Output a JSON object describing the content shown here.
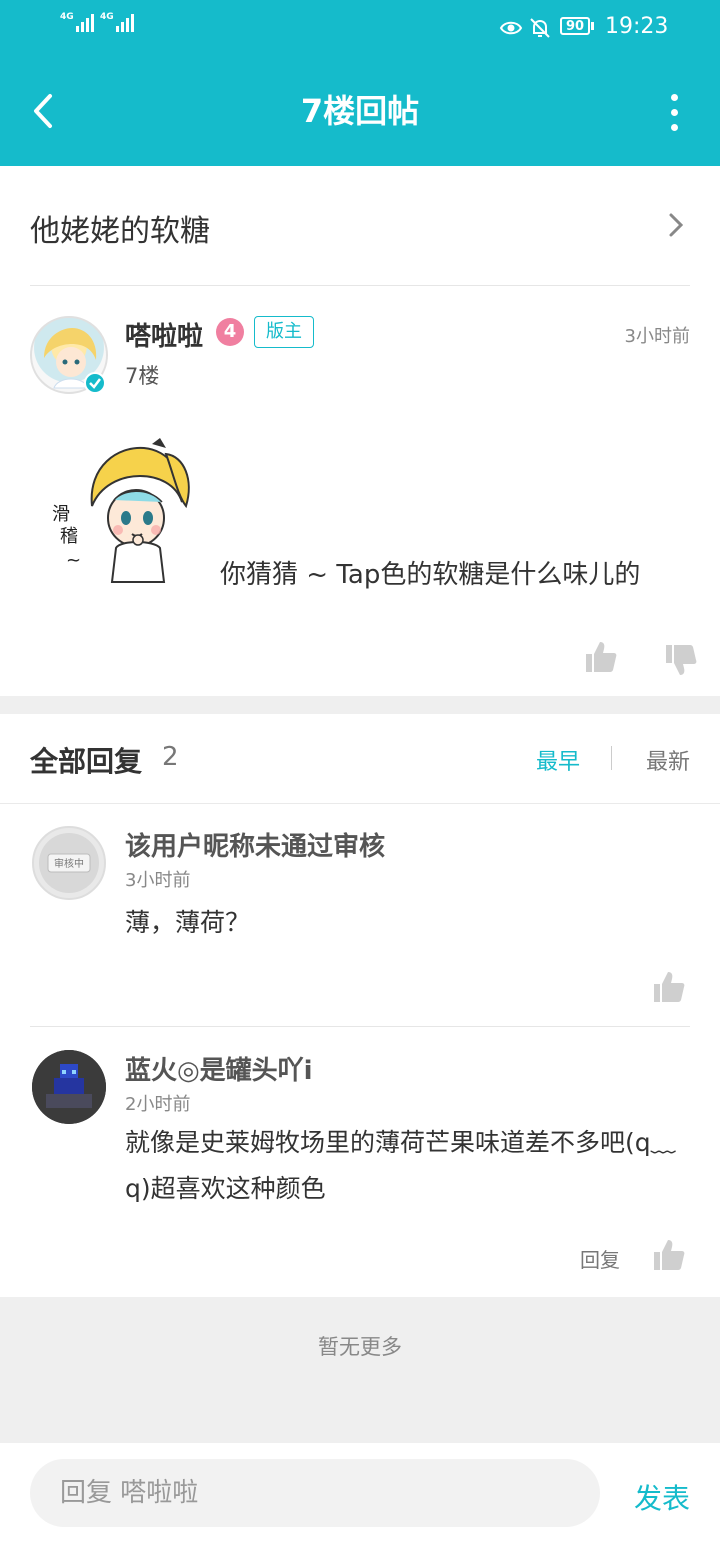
{
  "status_bar": {
    "signal1": "4G",
    "signal2": "4G",
    "battery": "90",
    "time": "19:23"
  },
  "header": {
    "title": "7楼回帖"
  },
  "topic": {
    "title": "他姥姥的软糖"
  },
  "post": {
    "author": "嗒啦啦",
    "level": "4",
    "role": "版主",
    "time": "3小时前",
    "floor": "7楼",
    "text": "你猜猜 ~ Tap色的软糖是什么味儿的",
    "sticker_text": "滑稽~"
  },
  "replies": {
    "label": "全部回复",
    "count": "2",
    "sort_early": "最早",
    "sort_new": "最新",
    "items": [
      {
        "name": "该用户昵称未通过审核",
        "time": "3小时前",
        "text": "薄，薄荷？",
        "avatar_text": "审核中",
        "reply_label": ""
      },
      {
        "name": "蓝火◎是罐头吖i",
        "time": "2小时前",
        "text": "就像是史莱姆牧场里的薄荷芒果味道差不多吧(q﹏q)超喜欢这种颜色",
        "reply_label": "回复"
      }
    ]
  },
  "footer": {
    "no_more": "暂无更多"
  },
  "composer": {
    "placeholder": "回复 嗒啦啦",
    "send_label": "发表"
  },
  "colors": {
    "accent": "#15bbcb",
    "level_badge": "#f07fa0"
  }
}
